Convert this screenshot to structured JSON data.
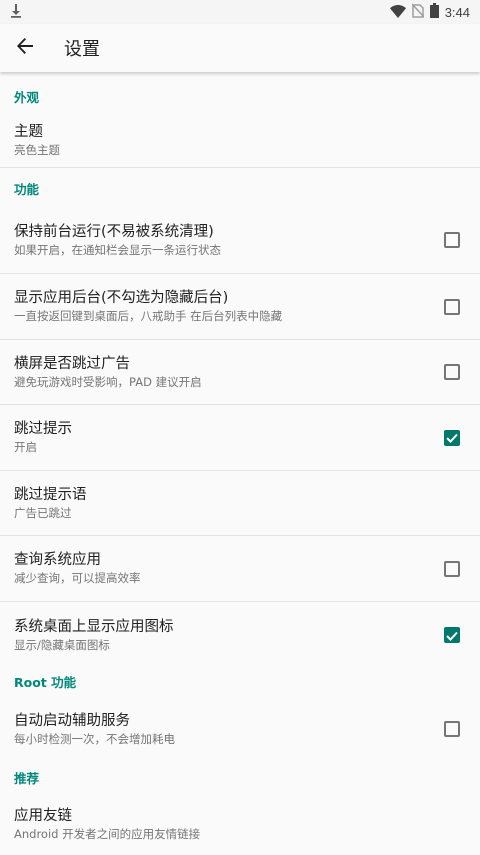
{
  "status_bar": {
    "time": "3:44",
    "icons": [
      "download-icon",
      "wifi-icon",
      "no-sim-icon",
      "battery-icon"
    ]
  },
  "toolbar": {
    "back_icon": "arrow-left-icon",
    "title": "设置"
  },
  "colors": {
    "accent": "#00897b",
    "checkbox_checked": "#00796b",
    "summary_text": "#757575"
  },
  "sections": {
    "appearance": {
      "header": "外观",
      "theme": {
        "title": "主题",
        "summary": "亮色主题"
      }
    },
    "features": {
      "header": "功能",
      "keep_foreground": {
        "title": "保持前台运行(不易被系统清理)",
        "summary": "如果开启，在通知栏会显示一条运行状态",
        "checked": false
      },
      "show_in_recents": {
        "title": "显示应用后台(不勾选为隐藏后台)",
        "summary": "一直按返回键到桌面后，八戒助手 在后台列表中隐藏",
        "checked": false
      },
      "landscape_skip": {
        "title": "横屏是否跳过广告",
        "summary": "避免玩游戏时受影响，PAD 建议开启",
        "checked": false
      },
      "skip_toast": {
        "title": "跳过提示",
        "summary": "开启",
        "checked": true
      },
      "skip_toast_text": {
        "title": "跳过提示语",
        "summary": "广告已跳过"
      },
      "query_system_apps": {
        "title": "查询系统应用",
        "summary": "减少查询，可以提高效率",
        "checked": false
      },
      "launcher_icon": {
        "title": "系统桌面上显示应用图标",
        "summary": "显示/隐藏桌面图标",
        "checked": true
      }
    },
    "root": {
      "header": "Root 功能",
      "auto_accessibility": {
        "title": "自动启动辅助服务",
        "summary": "每小时检测一次，不会增加耗电",
        "checked": false
      }
    },
    "recommend": {
      "header": "推荐",
      "friend_links": {
        "title": "应用友链",
        "summary": "Android 开发者之间的应用友情链接"
      }
    }
  }
}
